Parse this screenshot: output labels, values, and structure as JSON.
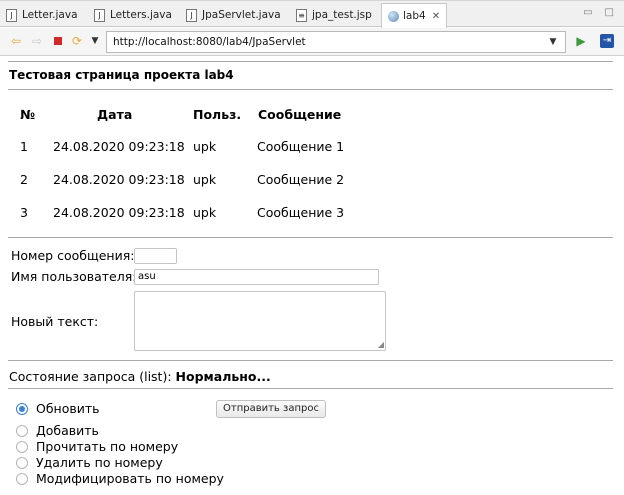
{
  "editor_tabs": [
    {
      "label": "Letter.java",
      "icon": "java-file-icon"
    },
    {
      "label": "Letters.java",
      "icon": "java-file-icon"
    },
    {
      "label": "JpaServlet.java",
      "icon": "java-file-icon"
    },
    {
      "label": "jpa_test.jsp",
      "icon": "jsp-file-icon"
    },
    {
      "label": "lab4",
      "icon": "globe-icon",
      "active": true
    }
  ],
  "toolbar": {
    "url": "http://localhost:8080/lab4/JpaServlet"
  },
  "page": {
    "heading": "Тестовая страница проекта lab4",
    "table": {
      "headers": [
        "№",
        "Дата",
        "Польз.",
        "Сообщение"
      ],
      "rows": [
        [
          "1",
          "24.08.2020 09:23:18",
          "upk",
          "Сообщение 1"
        ],
        [
          "2",
          "24.08.2020 09:23:18",
          "upk",
          "Сообщение 2"
        ],
        [
          "3",
          "24.08.2020 09:23:18",
          "upk",
          "Сообщение 3"
        ]
      ]
    },
    "form": {
      "msg_number_label": "Номер сообщения:",
      "msg_number_value": "",
      "username_label": "Имя пользователя:",
      "username_value": "asu",
      "new_text_label": "Новый текст:",
      "new_text_value": ""
    },
    "status": {
      "label": "Состояние запроса (list):",
      "value": "Нормально..."
    },
    "actions": [
      {
        "label": "Обновить",
        "checked": true
      },
      {
        "label": "Добавить",
        "checked": false
      },
      {
        "label": "Прочитать по номеру",
        "checked": false
      },
      {
        "label": "Удалить по номеру",
        "checked": false
      },
      {
        "label": "Модифицировать по номеру",
        "checked": false
      }
    ],
    "submit_label": "Отправить запрос"
  },
  "colors": {
    "radio_accent": "#3b7fd1",
    "stop_red": "#d22a2a",
    "nav_yellow": "#e9a93c",
    "go_green": "#3c9a3c"
  }
}
